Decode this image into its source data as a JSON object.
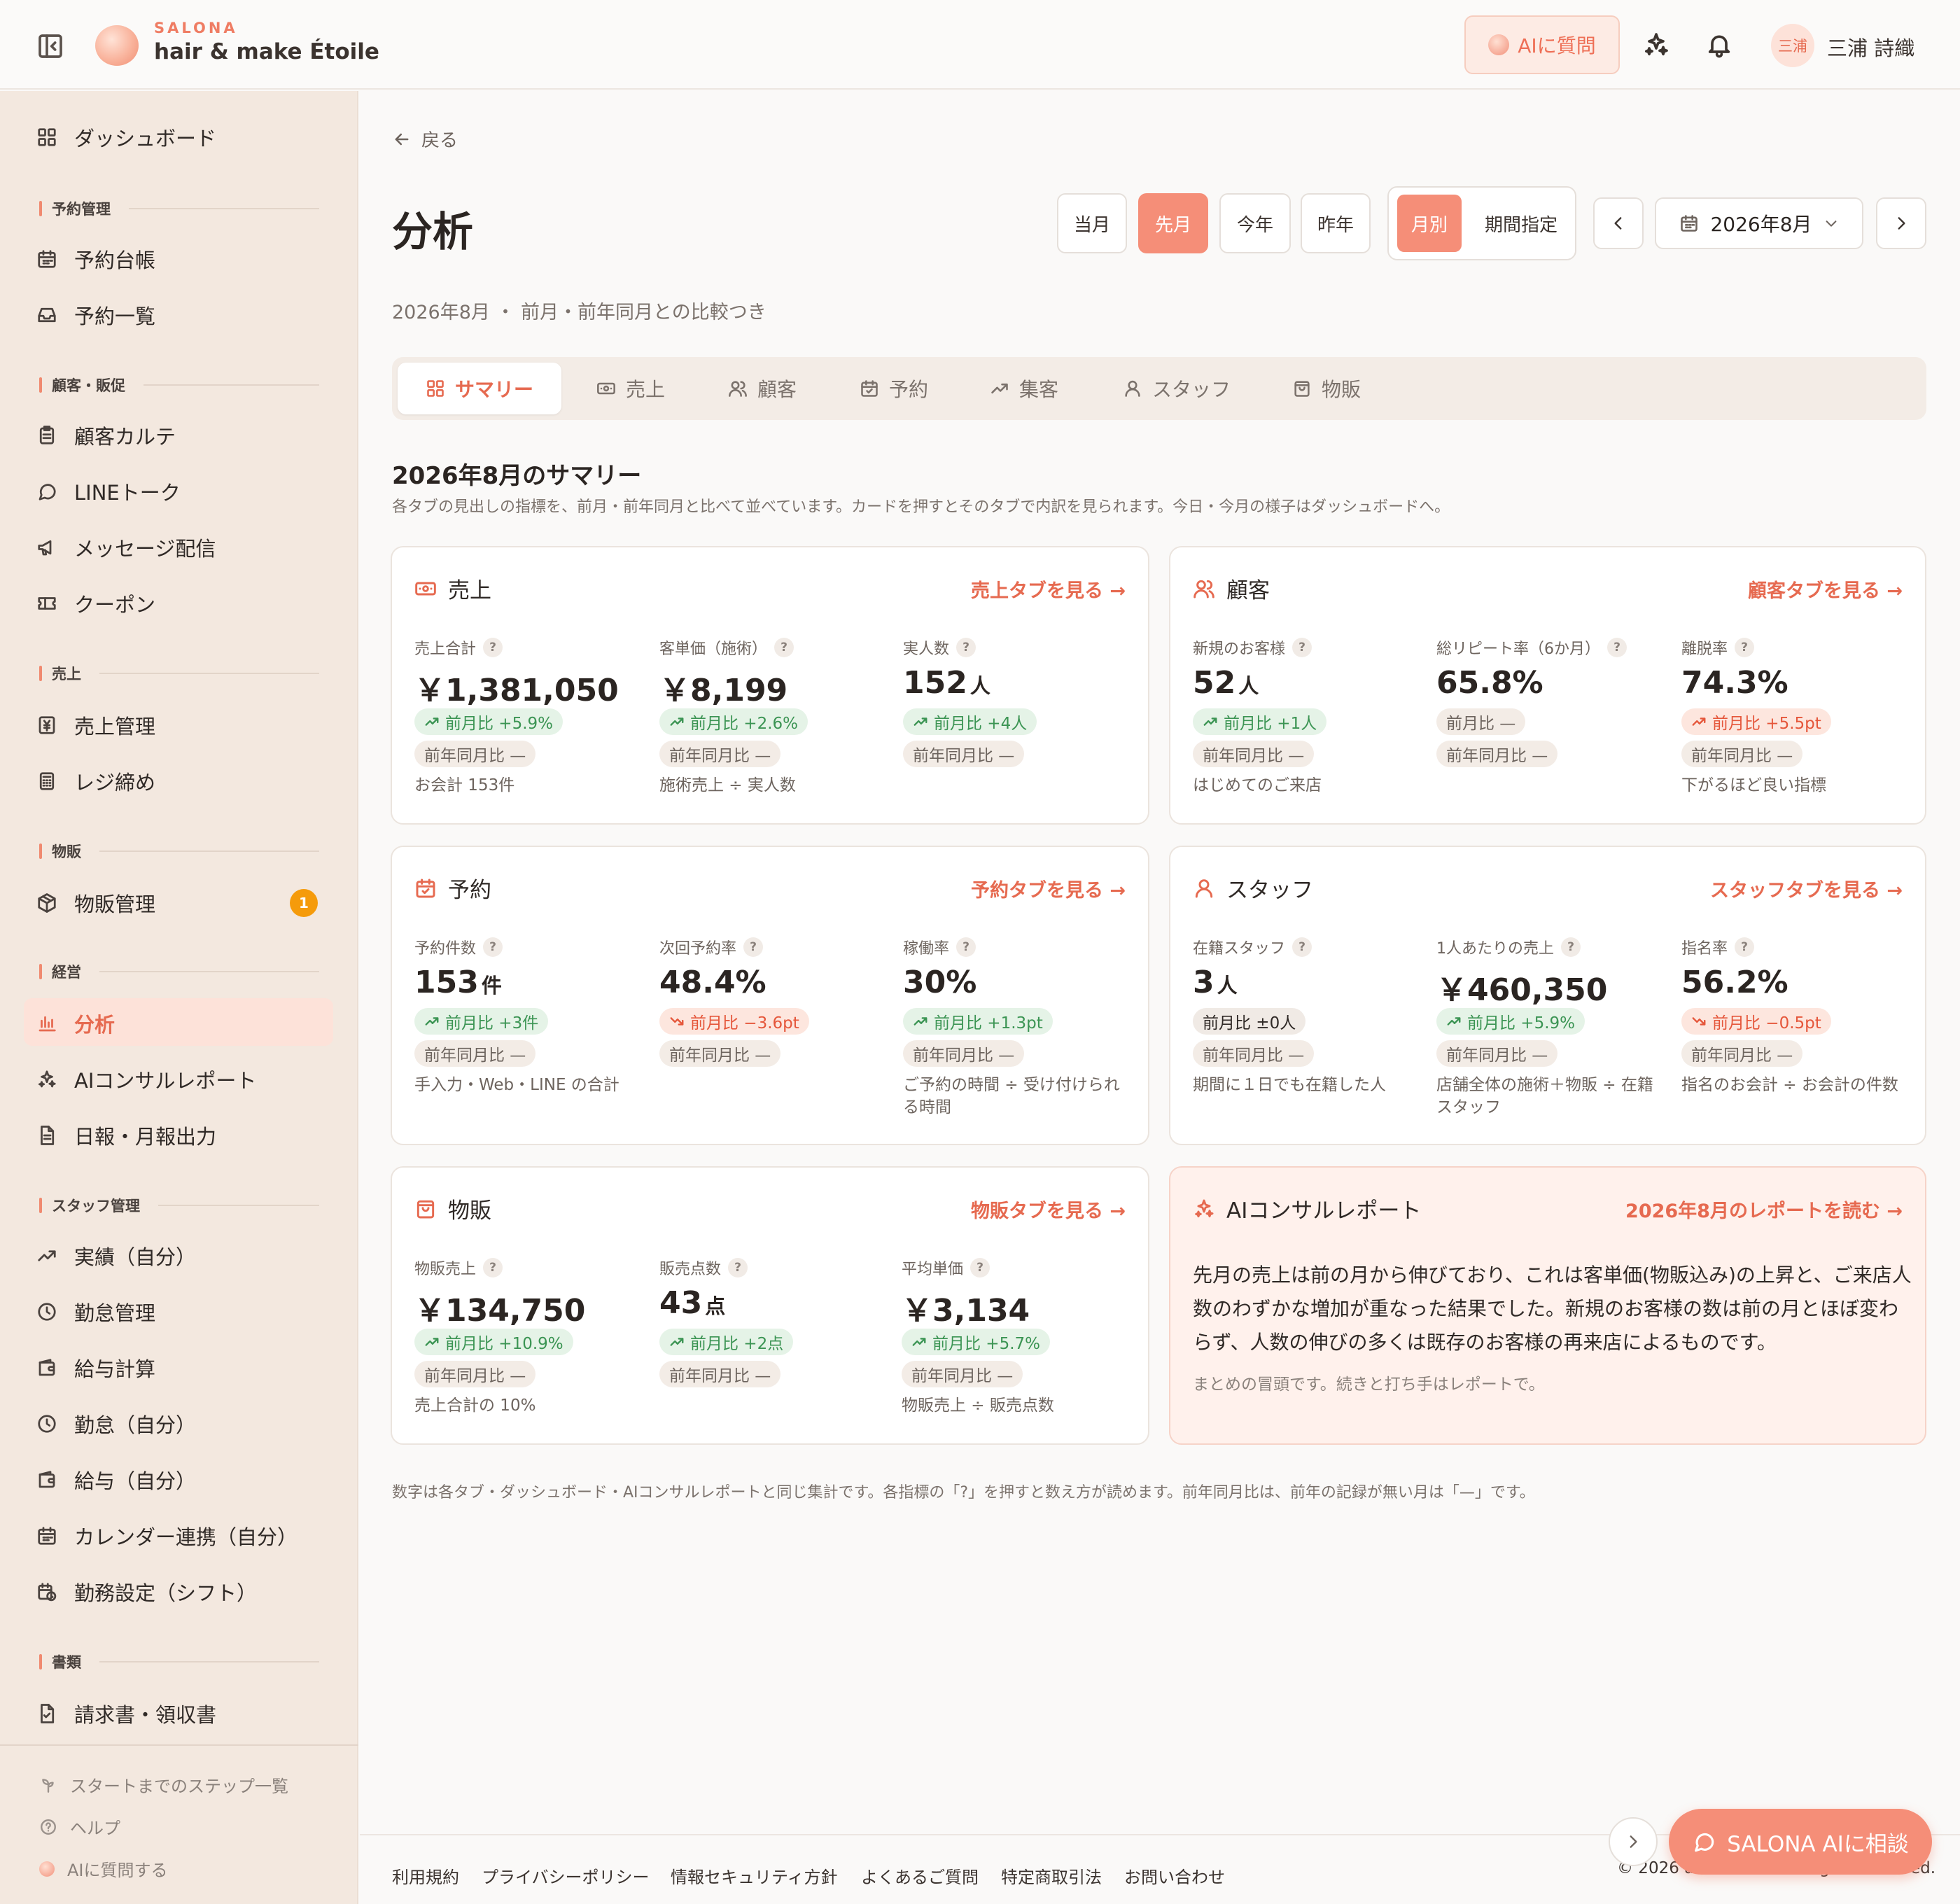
{
  "header": {
    "brand_sub": "SALONA",
    "brand_main": "hair & make Étoile",
    "ai_button": "AIに質問",
    "avatar": "三浦",
    "user_name": "三浦 詩織"
  },
  "sidebar": {
    "dashboard": "ダッシュボード",
    "sections": {
      "reservation": "予約管理",
      "customer": "顧客・販促",
      "sales": "売上",
      "retail": "物販",
      "management": "経営",
      "staff": "スタッフ管理",
      "docs": "書類"
    },
    "items": {
      "book": "予約台帳",
      "list": "予約一覧",
      "karte": "顧客カルテ",
      "line": "LINEトーク",
      "message": "メッセージ配信",
      "coupon": "クーポン",
      "sales_mgmt": "売上管理",
      "register": "レジ締め",
      "retail_mgmt": "物販管理",
      "analysis": "分析",
      "ai_report": "AIコンサルレポート",
      "daily_report": "日報・月報出力",
      "my_results": "実績（自分）",
      "attendance": "勤怠管理",
      "payroll": "給与計算",
      "my_attendance": "勤怠（自分）",
      "my_payroll": "給与（自分）",
      "calendar": "カレンダー連携（自分）",
      "shift": "勤務設定（シフト）",
      "invoice": "請求書・領収書"
    },
    "retail_badge": "1",
    "footer": {
      "steps": "スタートまでのステップ一覧",
      "help": "ヘルプ",
      "ask_ai": "AIに質問する"
    }
  },
  "main": {
    "back": "戻る",
    "title": "分析",
    "periods": [
      "当月",
      "先月",
      "今年",
      "昨年"
    ],
    "mode_monthly": "月別",
    "mode_range": "期間指定",
    "month": "2026年8月",
    "subtitle": "2026年8月 ・ 前月・前年同月との比較つき",
    "tabs": [
      "サマリー",
      "売上",
      "顧客",
      "予約",
      "集客",
      "スタッフ",
      "物販"
    ],
    "summary_title": "2026年8月のサマリー",
    "summary_desc": "各タブの見出しの指標を、前月・前年同月と比べて並べています。カードを押すとそのタブで内訳を見られます。今日・今月の様子はダッシュボードへ。",
    "footnote": "数字は各タブ・ダッシュボード・AIコンサルレポートと同じ集計です。各指標の「?」を押すと数え方が読めます。前年同月比は、前年の記録が無い月は「—」です。"
  },
  "help_mark": "?",
  "cards": {
    "sales": {
      "title": "売上",
      "link": "売上タブを見る →",
      "m1": {
        "label": "売上合計",
        "value": "￥1,381,050",
        "unit": "",
        "mom": "前月比 +5.9%",
        "yoy": "前年同月比 —",
        "note": "お会計 153件"
      },
      "m2": {
        "label": "客単価（施術）",
        "value": "￥8,199",
        "unit": "",
        "mom": "前月比 +2.6%",
        "yoy": "前年同月比 —",
        "note": "施術売上 ÷ 実人数"
      },
      "m3": {
        "label": "実人数",
        "value": "152",
        "unit": "人",
        "mom": "前月比 +4人",
        "yoy": "前年同月比 —",
        "note": ""
      }
    },
    "customer": {
      "title": "顧客",
      "link": "顧客タブを見る →",
      "m1": {
        "label": "新規のお客様",
        "value": "52",
        "unit": "人",
        "mom": "前月比 +1人",
        "yoy": "前年同月比 —",
        "note": "はじめてのご来店"
      },
      "m2": {
        "label": "総リピート率（6か月）",
        "value": "65.8%",
        "unit": "",
        "mom": "前月比 —",
        "yoy": "前年同月比 —",
        "note": ""
      },
      "m3": {
        "label": "離脱率",
        "value": "74.3%",
        "unit": "",
        "mom": "前月比 +5.5pt",
        "yoy": "前年同月比 —",
        "note": "下がるほど良い指標"
      }
    },
    "reservation": {
      "title": "予約",
      "link": "予約タブを見る →",
      "m1": {
        "label": "予約件数",
        "value": "153",
        "unit": "件",
        "mom": "前月比 +3件",
        "yoy": "前年同月比 —",
        "note": "手入力・Web・LINE の合計"
      },
      "m2": {
        "label": "次回予約率",
        "value": "48.4%",
        "unit": "",
        "mom": "前月比 −3.6pt",
        "yoy": "前年同月比 —",
        "note": ""
      },
      "m3": {
        "label": "稼働率",
        "value": "30%",
        "unit": "",
        "mom": "前月比 +1.3pt",
        "yoy": "前年同月比 —",
        "note": "ご予約の時間 ÷ 受け付けられる時間"
      }
    },
    "staff": {
      "title": "スタッフ",
      "link": "スタッフタブを見る →",
      "m1": {
        "label": "在籍スタッフ",
        "value": "3",
        "unit": "人",
        "mom": "前月比 ±0人",
        "yoy": "前年同月比 —",
        "note": "期間に１日でも在籍した人"
      },
      "m2": {
        "label": "1人あたりの売上",
        "value": "￥460,350",
        "unit": "",
        "mom": "前月比 +5.9%",
        "yoy": "前年同月比 —",
        "note": "店舗全体の施術＋物販 ÷ 在籍スタッフ"
      },
      "m3": {
        "label": "指名率",
        "value": "56.2%",
        "unit": "",
        "mom": "前月比 −0.5pt",
        "yoy": "前年同月比 —",
        "note": "指名のお会計 ÷ お会計の件数"
      }
    },
    "retail": {
      "title": "物販",
      "link": "物販タブを見る →",
      "m1": {
        "label": "物販売上",
        "value": "￥134,750",
        "unit": "",
        "mom": "前月比 +10.9%",
        "yoy": "前年同月比 —",
        "note": "売上合計の 10%"
      },
      "m2": {
        "label": "販売点数",
        "value": "43",
        "unit": "点",
        "mom": "前月比 +2点",
        "yoy": "前年同月比 —",
        "note": ""
      },
      "m3": {
        "label": "平均単価",
        "value": "￥3,134",
        "unit": "",
        "mom": "前月比 +5.7%",
        "yoy": "前年同月比 —",
        "note": "物販売上 ÷ 販売点数"
      }
    },
    "ai": {
      "title": "AIコンサルレポート",
      "link": "2026年8月のレポートを読む →",
      "body": "先月の売上は前の月から伸びており、これは客単価(物販込み)の上昇と、ご来店人数のわずかな増加が重なった結果でした。新規のお客様の数は前の月とほぼ変わらず、人数の伸びの多くは既存のお客様の再来店によるものです。",
      "note": "まとめの冒頭です。続きと打ち手はレポートで。"
    }
  },
  "footer": {
    "links": [
      "利用規約",
      "プライバシーポリシー",
      "情報セキュリティ方針",
      "よくあるご質問",
      "特定商取引法",
      "お問い合わせ"
    ],
    "copyright": "© 2026 artcraft Inc. All rights reserved.",
    "fab": "SALONA AIに相談"
  }
}
